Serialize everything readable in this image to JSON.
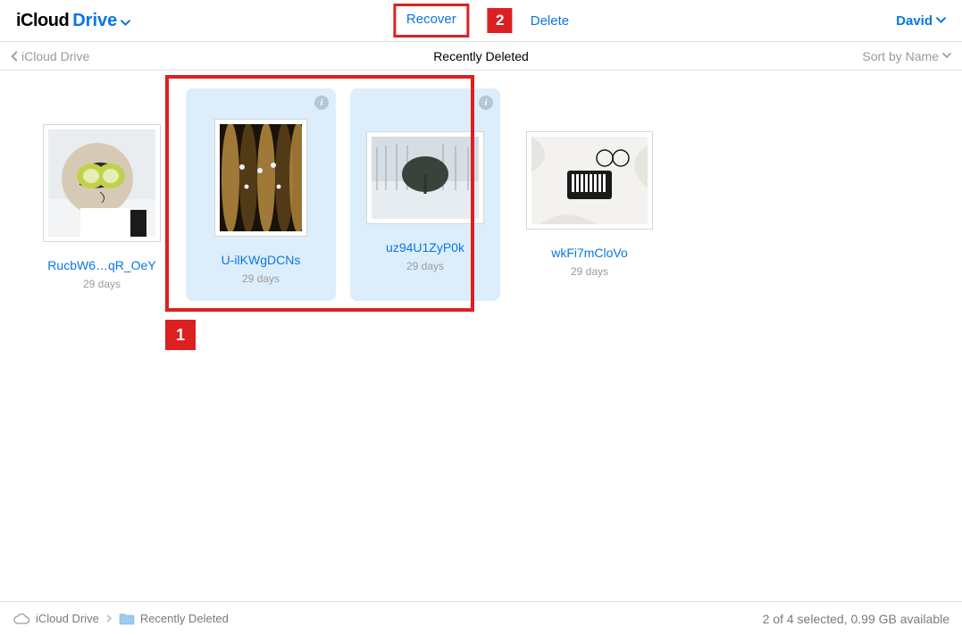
{
  "header": {
    "app_name_icloud": "iCloud",
    "app_name_drive": "Drive",
    "recover_label": "Recover",
    "delete_label": "Delete",
    "user_name": "David"
  },
  "subheader": {
    "back_label": "iCloud Drive",
    "page_title": "Recently Deleted",
    "sort_label": "Sort by Name"
  },
  "annotations": {
    "step1": "1",
    "step2": "2"
  },
  "files": [
    {
      "name": "RucbW6…qR_OeY",
      "meta": "29 days",
      "selected": false
    },
    {
      "name": "U-ilKWgDCNs",
      "meta": "29 days",
      "selected": true
    },
    {
      "name": "uz94U1ZyP0k",
      "meta": "29 days",
      "selected": true
    },
    {
      "name": "wkFi7mCloVo",
      "meta": "29 days",
      "selected": false
    }
  ],
  "footer": {
    "crumb_root": "iCloud Drive",
    "crumb_leaf": "Recently Deleted",
    "status": "2 of 4 selected, 0.99 GB available"
  }
}
